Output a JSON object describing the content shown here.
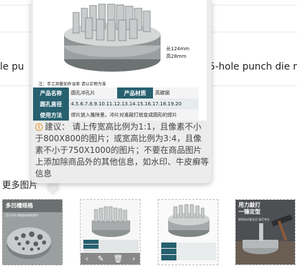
{
  "background": {
    "title_left": "le pu",
    "title_right": "g 5-hole punch die m",
    "more_label": "更多图片"
  },
  "popover": {
    "dim_length": "长124mm",
    "dim_height": "高28mm",
    "note": "注：手工测量如有误差 请以实物为准",
    "specs": [
      {
        "key": "产品名称",
        "value": "圆孔冲孔片",
        "key2": "产品材质",
        "value2": "高碳钢"
      },
      {
        "key": "圆孔直径",
        "value": "4.5.6.7.8.9.10.11.12.13.14.15.16.17.18.19.20"
      },
      {
        "key": "使用方法",
        "value": "焊片放入推除里，冲片对准敲打就变成圆形的焊片"
      }
    ],
    "advice": "建议：  请上传宽高比例为1:1，且像素不小于800X800的图片；或宽高比例为3:4，且像素不小于750X1000的图片；不要在商品图片上添加除商品外的其他信息，如水印、牛皮癣等信息",
    "advice_icon": "info-circle-icon"
  },
  "thumbnails": [
    {
      "caption": "多凹槽规格",
      "sub": "用于冲孔冲截各种规格零件",
      "style": "dark"
    },
    {
      "caption": "",
      "sub": "",
      "style": "light",
      "tools": [
        "chevron-left-icon",
        "edit-icon",
        "trash-icon",
        "chevron-right-icon"
      ]
    },
    {
      "caption": "",
      "sub": "",
      "style": "light"
    },
    {
      "caption": "用力敲打\n一锤定型",
      "sub": "把坯料对准孔位 敲打冲头",
      "style": "photo"
    }
  ],
  "colors": {
    "spec_key": "#27606f",
    "advice_icon": "#e89a2b",
    "popover_bg": "#ececec"
  }
}
